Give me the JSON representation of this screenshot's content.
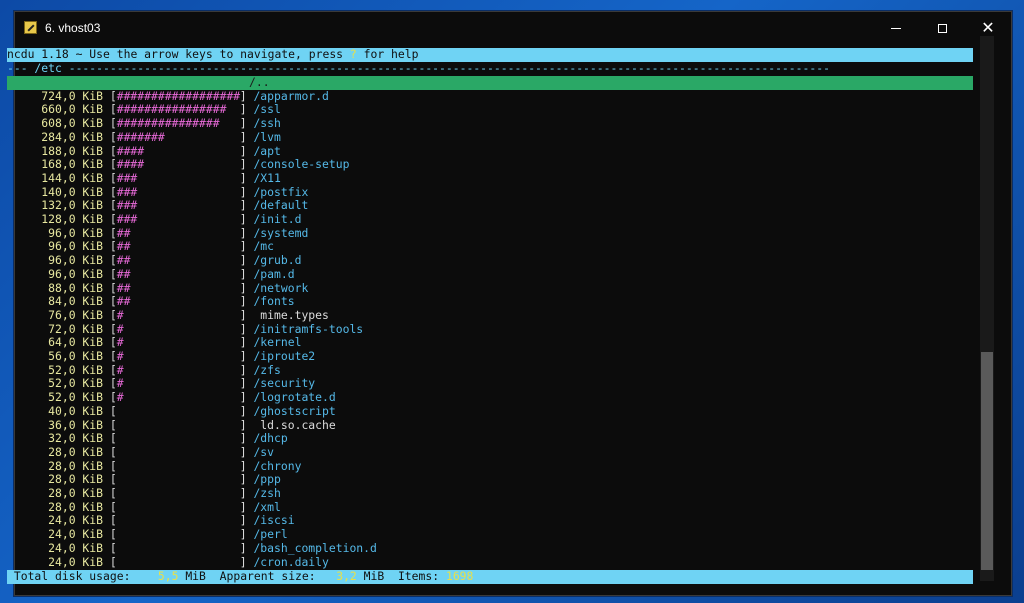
{
  "window": {
    "title": "6. vhost03",
    "icon": "terminal-app-icon",
    "controls": {
      "minimize": "minimize",
      "maximize": "maximize",
      "close": "close"
    }
  },
  "header": {
    "before": "ncdu 1.18 ~ Use the arrow keys to navigate, press ",
    "key": "?",
    "after": " for help"
  },
  "path_line": "--- /etc ---------------------------------------------------------------------------------------------------------------",
  "selected": "/..",
  "entries": [
    {
      "size": "724,0 KiB",
      "bar": "##################",
      "name": "/apparmor.d",
      "type": "dir"
    },
    {
      "size": "660,0 KiB",
      "bar": "################ ",
      "name": "/ssl",
      "type": "dir"
    },
    {
      "size": "608,0 KiB",
      "bar": "###############  ",
      "name": "/ssh",
      "type": "dir"
    },
    {
      "size": "284,0 KiB",
      "bar": "#######",
      "name": "/lvm",
      "type": "dir"
    },
    {
      "size": "188,0 KiB",
      "bar": "####",
      "name": "/apt",
      "type": "dir"
    },
    {
      "size": "168,0 KiB",
      "bar": "####",
      "name": "/console-setup",
      "type": "dir"
    },
    {
      "size": "144,0 KiB",
      "bar": "###",
      "name": "/X11",
      "type": "dir"
    },
    {
      "size": "140,0 KiB",
      "bar": "###",
      "name": "/postfix",
      "type": "dir"
    },
    {
      "size": "132,0 KiB",
      "bar": "###",
      "name": "/default",
      "type": "dir"
    },
    {
      "size": "128,0 KiB",
      "bar": "###",
      "name": "/init.d",
      "type": "dir"
    },
    {
      "size": "96,0 KiB",
      "bar": "##",
      "name": "/systemd",
      "type": "dir"
    },
    {
      "size": "96,0 KiB",
      "bar": "##",
      "name": "/mc",
      "type": "dir"
    },
    {
      "size": "96,0 KiB",
      "bar": "##",
      "name": "/grub.d",
      "type": "dir"
    },
    {
      "size": "96,0 KiB",
      "bar": "##",
      "name": "/pam.d",
      "type": "dir"
    },
    {
      "size": "88,0 KiB",
      "bar": "##",
      "name": "/network",
      "type": "dir"
    },
    {
      "size": "84,0 KiB",
      "bar": "##",
      "name": "/fonts",
      "type": "dir"
    },
    {
      "size": "76,0 KiB",
      "bar": "#",
      "name": " mime.types",
      "type": "file"
    },
    {
      "size": "72,0 KiB",
      "bar": "#",
      "name": "/initramfs-tools",
      "type": "dir"
    },
    {
      "size": "64,0 KiB",
      "bar": "#",
      "name": "/kernel",
      "type": "dir"
    },
    {
      "size": "56,0 KiB",
      "bar": "#",
      "name": "/iproute2",
      "type": "dir"
    },
    {
      "size": "52,0 KiB",
      "bar": "#",
      "name": "/zfs",
      "type": "dir"
    },
    {
      "size": "52,0 KiB",
      "bar": "#",
      "name": "/security",
      "type": "dir"
    },
    {
      "size": "52,0 KiB",
      "bar": "#",
      "name": "/logrotate.d",
      "type": "dir"
    },
    {
      "size": "40,0 KiB",
      "bar": "",
      "name": "/ghostscript",
      "type": "dir"
    },
    {
      "size": "36,0 KiB",
      "bar": "",
      "name": " ld.so.cache",
      "type": "file"
    },
    {
      "size": "32,0 KiB",
      "bar": "",
      "name": "/dhcp",
      "type": "dir"
    },
    {
      "size": "28,0 KiB",
      "bar": "",
      "name": "/sv",
      "type": "dir"
    },
    {
      "size": "28,0 KiB",
      "bar": "",
      "name": "/chrony",
      "type": "dir"
    },
    {
      "size": "28,0 KiB",
      "bar": "",
      "name": "/ppp",
      "type": "dir"
    },
    {
      "size": "28,0 KiB",
      "bar": "",
      "name": "/zsh",
      "type": "dir"
    },
    {
      "size": "28,0 KiB",
      "bar": "",
      "name": "/xml",
      "type": "dir"
    },
    {
      "size": "24,0 KiB",
      "bar": "",
      "name": "/iscsi",
      "type": "dir"
    },
    {
      "size": "24,0 KiB",
      "bar": "",
      "name": "/perl",
      "type": "dir"
    },
    {
      "size": "24,0 KiB",
      "bar": "",
      "name": "/bash_completion.d",
      "type": "dir"
    },
    {
      "size": "24,0 KiB",
      "bar": "",
      "name": "/cron.daily",
      "type": "dir"
    }
  ],
  "footer": {
    "total_label": " Total disk usage:",
    "total_value": "5,5",
    "total_unit": "MiB",
    "apparent_label": "Apparent size:",
    "apparent_value": "3,2",
    "apparent_unit": "MiB",
    "items_label": "Items:",
    "items_value": "1698"
  },
  "colors": {
    "header_bg": "#6fd3f4",
    "selection_bg": "#2aa866",
    "bar": "#e86ad8",
    "directory": "#55b9e8",
    "size": "#e8e8a0"
  }
}
